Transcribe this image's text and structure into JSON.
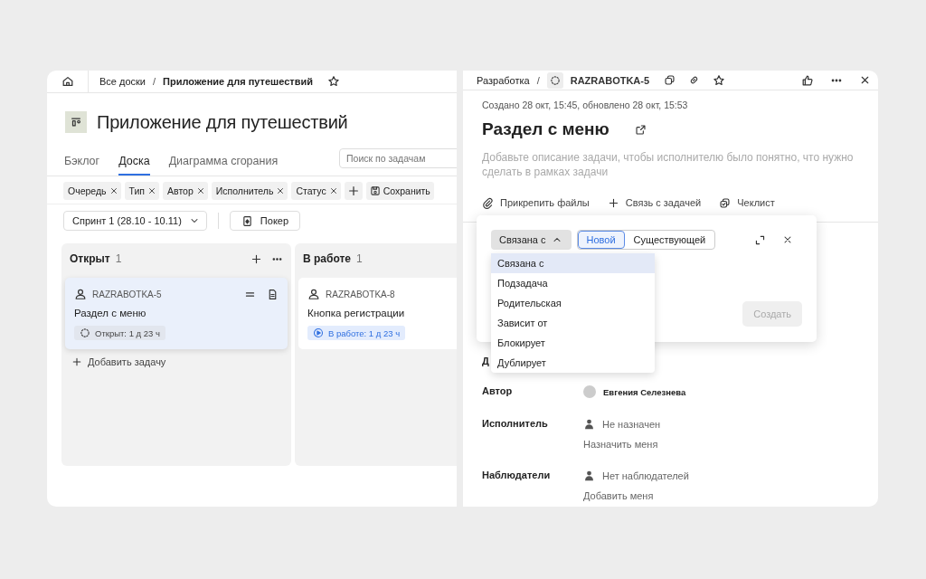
{
  "board": {
    "breadcrumbs": [
      "Все доски",
      "Приложение для путешествий"
    ],
    "breadcrumb_separator": "/",
    "title": "Приложение для путешествий",
    "tabs": [
      {
        "label": "Бэклог",
        "selected": false
      },
      {
        "label": "Доска",
        "selected": true
      },
      {
        "label": "Диаграмма сгорания",
        "selected": false
      }
    ],
    "search": {
      "placeholder": "Поиск по задачам"
    },
    "filters": [
      "Очередь",
      "Тип",
      "Автор",
      "Исполнитель",
      "Статус"
    ],
    "save_button": "Сохранить",
    "sprint": "Спринт 1 (28.10 - 10.11)",
    "poker_button": "Покер",
    "columns": [
      {
        "name": "Открыт",
        "count": "1",
        "add_task": "Добавить задачу",
        "cards": [
          {
            "key": "RAZRABOTKA-5",
            "title": "Раздел с меню",
            "status": "Открыт: 1 д 23 ч",
            "kind": "open",
            "selected": true
          }
        ]
      },
      {
        "name": "В работе",
        "count": "1",
        "cards": [
          {
            "key": "RAZRABOTKA-8",
            "title": "Кнопка регистрации",
            "status": "В работе: 1 д 23 ч",
            "kind": "in_progress",
            "selected": false
          }
        ]
      }
    ]
  },
  "issue": {
    "breadcrumb": "Разработка",
    "breadcrumb_separator": "/",
    "key": "RAZRABOTKA-5",
    "meta": "Создано 28 окт, 15:45, обновлено 28 окт, 15:53",
    "title": "Раздел с меню",
    "description": {
      "placeholder": "Добавьте описание задачи, чтобы исполнителю было понятно, что нужно сделать в рамках задачи"
    },
    "actions": [
      {
        "kind": "attach",
        "label": "Прикрепить файлы"
      },
      {
        "kind": "link",
        "label": "Связь с задачей"
      },
      {
        "kind": "checklist",
        "label": "Чеклист"
      }
    ],
    "link_popup": {
      "relation": "Связана с",
      "expanded": true,
      "modes": [
        {
          "label": "Новой",
          "selected": true
        },
        {
          "label": "Существующей",
          "selected": false
        }
      ],
      "create_button": "Создать",
      "create_disabled": true,
      "options": [
        {
          "label": "Связана с",
          "selected": true
        },
        {
          "label": "Подзадача",
          "selected": false
        },
        {
          "label": "Родительская",
          "selected": false
        },
        {
          "label": "Зависит от",
          "selected": false
        },
        {
          "label": "Блокирует",
          "selected": false
        },
        {
          "label": "Дублирует",
          "selected": false
        }
      ]
    },
    "fields": [
      {
        "label": "Д"
      },
      {
        "label": "Автор",
        "kind": "user",
        "value": "Евгения Селезнева"
      },
      {
        "label": "Исполнитель",
        "kind": "empty",
        "value": "Не назначен",
        "action": "Назначить меня"
      },
      {
        "label": "Наблюдатели",
        "kind": "empty",
        "value": "Нет наблюдателей",
        "action": "Добавить меня"
      }
    ]
  }
}
